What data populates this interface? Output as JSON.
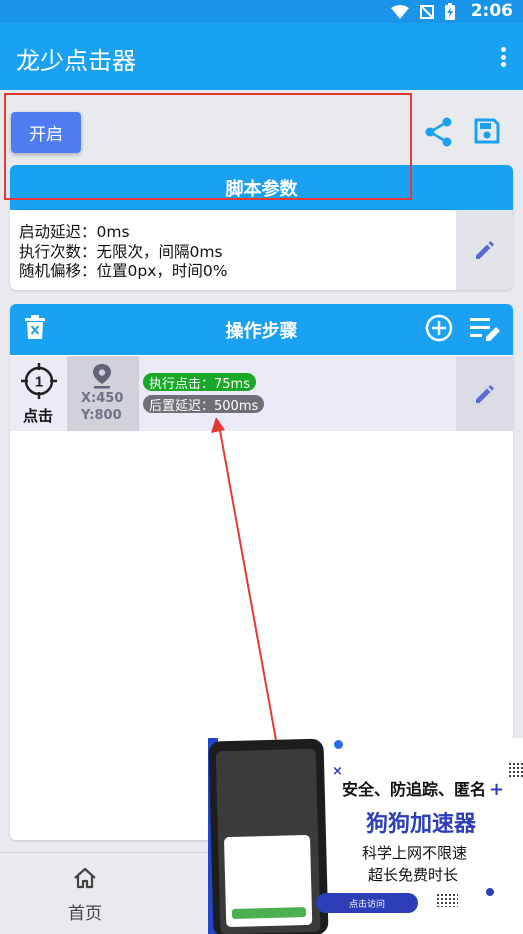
{
  "status_bar": {
    "time": "2:06"
  },
  "app_bar": {
    "title": "龙少点击器"
  },
  "toolbar": {
    "start_label": "开启"
  },
  "script_params": {
    "title": "脚本参数",
    "lines": [
      "启动延迟：0ms",
      "执行次数：无限次，间隔0ms",
      "随机偏移：位置0px，时间0%"
    ]
  },
  "steps": {
    "title": "操作步骤",
    "items": [
      {
        "index": "1",
        "type": "点击",
        "x": "X:450",
        "y": "Y:800",
        "exec_badge": "执行点击：75ms",
        "delay_badge": "后置延迟：500ms"
      }
    ]
  },
  "bottom_nav": {
    "home_label": "首页"
  },
  "ad": {
    "line1": "安全、防追踪、匿名",
    "line2": "狗狗加速器",
    "line3": "科学上网不限速",
    "line4": "超长免费时长",
    "cta": "点击访问"
  },
  "colors": {
    "primary": "#1ba1f1",
    "button": "#4f7cf0",
    "annotation": "#e53935",
    "exec_badge": "#1aa829",
    "delay_badge": "#6f6f75"
  }
}
